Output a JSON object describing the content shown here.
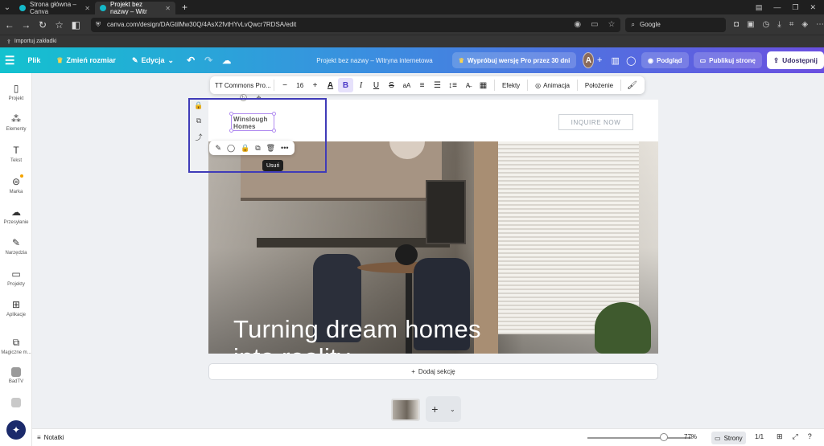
{
  "browser": {
    "tabs": [
      {
        "label": "Strona główna – Canva",
        "active": false
      },
      {
        "label": "Projekt bez nazwy – Witr",
        "active": true
      }
    ],
    "url": "canva.com/design/DAGtilMw30Q/4AsX2fvtHYvLvQwcr7RDSA/edit",
    "search_engine": "Google",
    "bookmark_import": "Importuj zakładki"
  },
  "header": {
    "file": "Plik",
    "resize": "Zmień rozmiar",
    "edit": "Edycja",
    "doc_title": "Projekt bez nazwy – Witryna internetowa",
    "try_pro": "Wypróbuj wersję Pro przez 30 dni",
    "avatar_initial": "A",
    "preview": "Podgląd",
    "publish": "Publikuj stronę",
    "share": "Udostępnij"
  },
  "sidebar": {
    "items": [
      {
        "label": "Projekt",
        "icon": "layout-icon"
      },
      {
        "label": "Elementy",
        "icon": "elements-icon"
      },
      {
        "label": "Tekst",
        "icon": "text-icon"
      },
      {
        "label": "Marka",
        "icon": "brand-icon"
      },
      {
        "label": "Przesyłanie",
        "icon": "upload-icon"
      },
      {
        "label": "Narzędzia",
        "icon": "tools-icon"
      },
      {
        "label": "Projekty",
        "icon": "folder-icon"
      },
      {
        "label": "Aplikacje",
        "icon": "apps-icon"
      },
      {
        "label": "Magiczne m...",
        "icon": "magic-icon"
      },
      {
        "label": "BadTV",
        "icon": "app-thumb-icon"
      },
      {
        "label": "",
        "icon": "app-thumb-icon"
      }
    ]
  },
  "toolbar": {
    "font": "TT Commons Pro...",
    "font_size": "16",
    "effects": "Efekty",
    "animation": "Animacja",
    "position": "Położenie"
  },
  "canvas": {
    "logo_line1": "Winslough",
    "logo_line2": "Homes",
    "inquire": "INQUIRE NOW",
    "headline_line1": "Turning dream homes",
    "headline_line2": "into reality."
  },
  "tooltip": "Usuń",
  "add_section": "Dodaj sekcję",
  "status": {
    "notes": "Notatki",
    "zoom": "77%",
    "zoom_fraction": 0.7,
    "pages": "Strony",
    "page_count": "1/1"
  },
  "colors": {
    "header_start": "#13c2cf",
    "header_end": "#6a4fe0",
    "selection_outline": "#3f3bb8",
    "element_selection": "#b18cf0",
    "active_bold": "#4b3ac7"
  }
}
